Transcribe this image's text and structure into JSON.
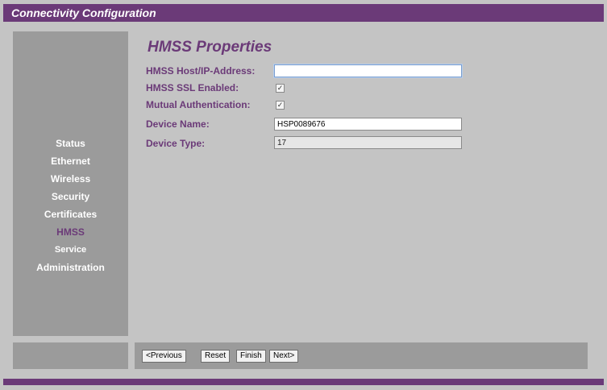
{
  "window": {
    "title": "Connectivity Configuration"
  },
  "colors": {
    "brand": "#6b3a78",
    "panel": "#9b9b9b",
    "background": "#c4c4c4"
  },
  "sidebar": {
    "items": [
      {
        "label": "Status",
        "active": false
      },
      {
        "label": "Ethernet",
        "active": false
      },
      {
        "label": "Wireless",
        "active": false
      },
      {
        "label": "Security",
        "active": false
      },
      {
        "label": "Certificates",
        "active": false
      },
      {
        "label": "HMSS",
        "active": true
      },
      {
        "label": "Service",
        "active": false
      },
      {
        "label": "Administration",
        "active": false
      }
    ]
  },
  "main": {
    "heading": "HMSS  Properties",
    "fields": {
      "host": {
        "label": "HMSS Host/IP-Address:",
        "value": ""
      },
      "ssl": {
        "label": "HMSS SSL Enabled:",
        "checked": true
      },
      "mutual": {
        "label": "Mutual Authentication:",
        "checked": true
      },
      "device_name": {
        "label": "Device Name:",
        "value": "HSP0089676"
      },
      "device_type": {
        "label": "Device Type:",
        "value": "17"
      }
    }
  },
  "buttons": {
    "previous": "<Previous",
    "reset": "Reset",
    "finish": "Finish",
    "next": "Next>"
  }
}
